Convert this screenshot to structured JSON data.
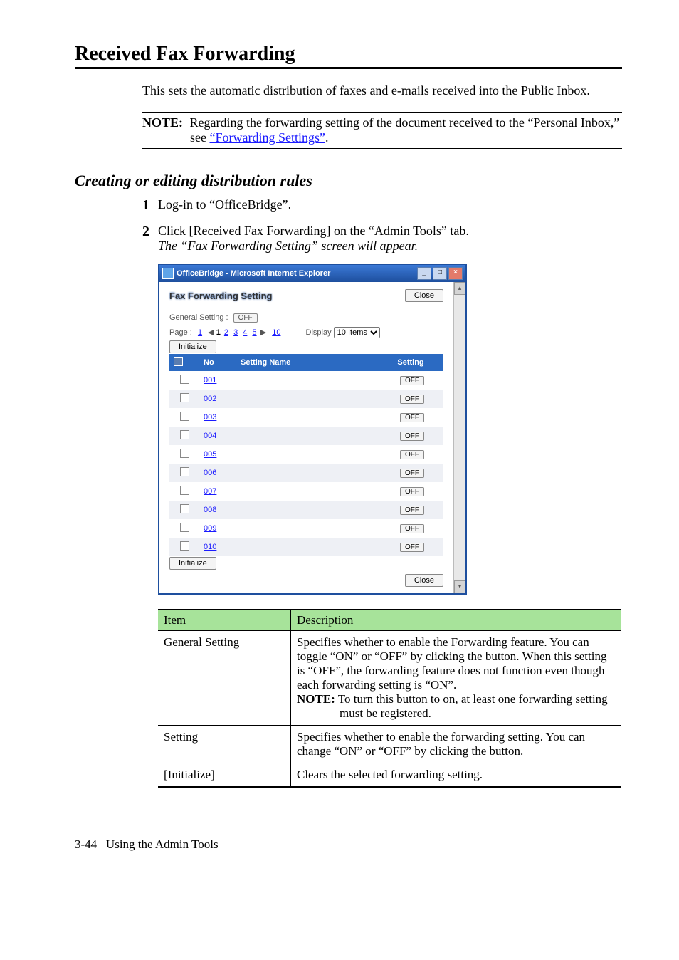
{
  "heading": "Received Fax Forwarding",
  "intro": "This sets the automatic distribution of faxes and e-mails received into the Public Inbox.",
  "note": {
    "label": "NOTE:",
    "text_before_link": "Regarding the forwarding setting of the document received to the “Personal Inbox,” see ",
    "link_text": "“Forwarding Settings”",
    "after": "."
  },
  "subheading": "Creating or editing distribution rules",
  "steps": {
    "s1": {
      "num": "1",
      "text": "Log-in to “OfficeBridge”."
    },
    "s2": {
      "num": "2",
      "line1": "Click [Received Fax Forwarding] on the “Admin Tools” tab.",
      "line2": "The “Fax Forwarding Setting” screen will appear."
    }
  },
  "window": {
    "title": "OfficeBridge - Microsoft Internet Explorer",
    "panel_title": "Fax Forwarding Setting",
    "close_btn": "Close",
    "general_setting_label": "General Setting :",
    "general_setting_value": "OFF",
    "page_label": "Page :",
    "page_first": "1",
    "page_links": [
      "1",
      "2",
      "3",
      "4",
      "5"
    ],
    "page_last": "10",
    "display_label": "Display",
    "display_value": "10 Items",
    "initialize_btn": "Initialize",
    "columns": {
      "no": "No",
      "name": "Setting Name",
      "setting": "Setting"
    },
    "rows": [
      {
        "no": "001",
        "setting": "OFF"
      },
      {
        "no": "002",
        "setting": "OFF"
      },
      {
        "no": "003",
        "setting": "OFF"
      },
      {
        "no": "004",
        "setting": "OFF"
      },
      {
        "no": "005",
        "setting": "OFF"
      },
      {
        "no": "006",
        "setting": "OFF"
      },
      {
        "no": "007",
        "setting": "OFF"
      },
      {
        "no": "008",
        "setting": "OFF"
      },
      {
        "no": "009",
        "setting": "OFF"
      },
      {
        "no": "010",
        "setting": "OFF"
      }
    ],
    "footer_close": "Close"
  },
  "desc_table": {
    "head_item": "Item",
    "head_desc": "Description",
    "rows": {
      "r1": {
        "item": "General Setting",
        "p1": "Specifies whether to enable the Forwarding feature. You can toggle “ON” or “OFF” by clicking the button. When this setting is “OFF”, the forwarding feature does not function even though each forwarding setting is “ON”.",
        "note_label": "NOTE:",
        "note_text": " To turn this button to on, at least one forwarding setting must be registered."
      },
      "r2": {
        "item": "Setting",
        "desc": "Specifies whether to enable the forwarding setting. You can change “ON” or “OFF” by clicking the button."
      },
      "r3": {
        "item": "[Initialize]",
        "desc": "Clears the selected forwarding setting."
      }
    }
  },
  "footer": {
    "pagenum": "3-44",
    "text": "Using the Admin Tools"
  }
}
